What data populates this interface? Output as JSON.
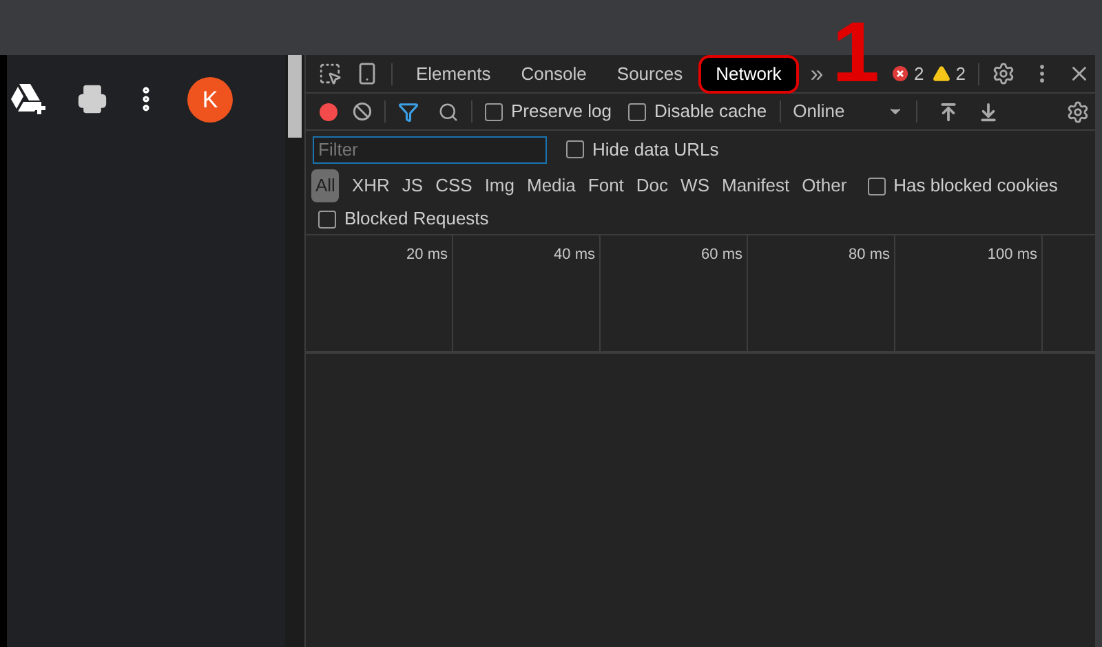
{
  "annotation": {
    "number": "1"
  },
  "sidebar": {
    "avatar": "K"
  },
  "devtools": {
    "tabs": [
      {
        "label": "Elements",
        "selected": false,
        "circled": false
      },
      {
        "label": "Console",
        "selected": false,
        "circled": false
      },
      {
        "label": "Sources",
        "selected": false,
        "circled": false
      },
      {
        "label": "Network",
        "selected": true,
        "circled": true
      }
    ],
    "more_tabs": "»",
    "errors": "2",
    "warnings": "2",
    "toolbar": {
      "recording": true,
      "filter_active": true,
      "checkboxes": [
        {
          "label": "Preserve log",
          "checked": false
        },
        {
          "label": "Disable cache",
          "checked": false
        }
      ],
      "throttling": "Online"
    },
    "filter": {
      "placeholder": "Filter",
      "hide_data_urls": {
        "label": "Hide data URLs",
        "checked": false
      }
    },
    "types": [
      {
        "label": "All",
        "selected": true
      },
      {
        "label": "XHR",
        "selected": false
      },
      {
        "label": "JS",
        "selected": false
      },
      {
        "label": "CSS",
        "selected": false
      },
      {
        "label": "Img",
        "selected": false
      },
      {
        "label": "Media",
        "selected": false
      },
      {
        "label": "Font",
        "selected": false
      },
      {
        "label": "Doc",
        "selected": false
      },
      {
        "label": "WS",
        "selected": false
      },
      {
        "label": "Manifest",
        "selected": false
      },
      {
        "label": "Other",
        "selected": false
      }
    ],
    "has_blocked_cookies": {
      "label": "Has blocked cookies",
      "checked": false
    },
    "blocked_requests": {
      "label": "Blocked Requests",
      "checked": false
    },
    "timeline_ticks": [
      "20 ms",
      "40 ms",
      "60 ms",
      "80 ms",
      "100 ms"
    ]
  }
}
